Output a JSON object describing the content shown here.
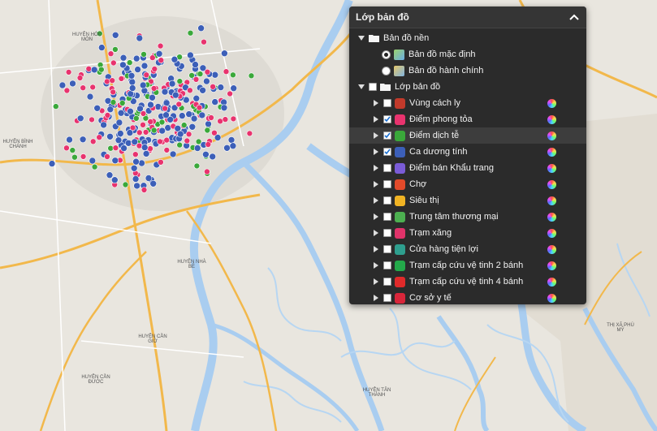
{
  "panel": {
    "title": "Lớp bản đồ",
    "base_group": {
      "label": "Bản đồ nền",
      "options": [
        {
          "label": "Bản đồ mặc định",
          "selected": true
        },
        {
          "label": "Bản đồ hành chính",
          "selected": false
        }
      ]
    },
    "layer_group": {
      "label": "Lớp bản đồ",
      "layers": [
        {
          "label": "Vùng cách ly",
          "checked": false,
          "icon": "quarantine-zone-icon",
          "color": "#c23a2b"
        },
        {
          "label": "Điểm phong tỏa",
          "checked": true,
          "icon": "lockdown-point-icon",
          "color": "#e8336e"
        },
        {
          "label": "Điểm dịch tễ",
          "checked": true,
          "icon": "epidemic-point-icon",
          "color": "#3aa83a"
        },
        {
          "label": "Ca dương tính",
          "checked": true,
          "icon": "positive-case-icon",
          "color": "#3c5fb8"
        },
        {
          "label": "Điểm bán Khẩu trang",
          "checked": false,
          "icon": "mask-shop-icon",
          "color": "#7a5bd6"
        },
        {
          "label": "Chợ",
          "checked": false,
          "icon": "market-icon",
          "color": "#e24a2a"
        },
        {
          "label": "Siêu thị",
          "checked": false,
          "icon": "supermarket-icon",
          "color": "#f0b323"
        },
        {
          "label": "Trung tâm thương mại",
          "checked": false,
          "icon": "mall-icon",
          "color": "#4caf50"
        },
        {
          "label": "Trạm xăng",
          "checked": false,
          "icon": "gas-station-icon",
          "color": "#e0336a"
        },
        {
          "label": "Cửa hàng tiện lợi",
          "checked": false,
          "icon": "convenience-store-icon",
          "color": "#2e9e8e"
        },
        {
          "label": "Trạm cấp cứu vệ tinh 2 bánh",
          "checked": false,
          "icon": "first-aid-2w-icon",
          "color": "#23a94a"
        },
        {
          "label": "Trạm cấp cứu vệ tinh 4 bánh",
          "checked": false,
          "icon": "first-aid-4w-icon",
          "color": "#e02a2a"
        },
        {
          "label": "Cơ sở y tế",
          "checked": false,
          "icon": "medical-facility-icon",
          "color": "#d9263a"
        }
      ]
    }
  },
  "map_labels": [
    "HUYỆN HÓC MÔN",
    "HUYỆN BÌNH CHÁNH",
    "HUYỆN NHÀ BÈ",
    "HUYỆN CẦN GIỜ",
    "HUYỆN CẦN ĐƯỚC",
    "HUYỆN TÂN THÀNH",
    "THỊ XÃ PHÚ MỸ"
  ]
}
